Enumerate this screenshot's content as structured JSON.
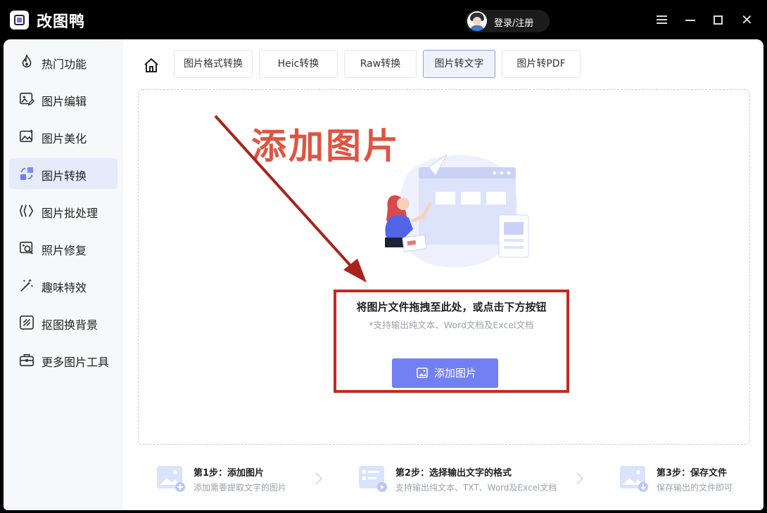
{
  "app": {
    "title": "改图鸭",
    "login_label": "登录/注册"
  },
  "sidebar": {
    "items": [
      {
        "label": "热门功能",
        "icon": "flame-icon"
      },
      {
        "label": "图片编辑",
        "icon": "image-edit-icon"
      },
      {
        "label": "图片美化",
        "icon": "image-beautify-icon"
      },
      {
        "label": "图片转换",
        "icon": "convert-icon",
        "active": true
      },
      {
        "label": "图片批处理",
        "icon": "batch-icon"
      },
      {
        "label": "照片修复",
        "icon": "photo-repair-icon"
      },
      {
        "label": "趣味特效",
        "icon": "magic-wand-icon"
      },
      {
        "label": "抠图换背景",
        "icon": "cutout-icon"
      },
      {
        "label": "更多图片工具",
        "icon": "toolbox-icon"
      }
    ]
  },
  "tabs": [
    {
      "label": "图片格式转换"
    },
    {
      "label": "Heic转换"
    },
    {
      "label": "Raw转换"
    },
    {
      "label": "图片转文字",
      "active": true
    },
    {
      "label": "图片转PDF"
    }
  ],
  "dropzone": {
    "annotation": "添加图片",
    "title": "将图片文件拖拽至此处，或点击下方按钮",
    "subtitle": "*支持输出纯文本、Word文档及Excel文档",
    "button_label": "添加图片"
  },
  "steps": [
    {
      "title": "第1步：添加图片",
      "desc": "添加需要提取文字的图片"
    },
    {
      "title": "第2步：选择输出文字的格式",
      "desc": "支持输出纯文本、TXT、Word及Excel文档"
    },
    {
      "title": "第3步：保存文件",
      "desc": "保存输出的文件即可"
    }
  ],
  "colors": {
    "accent": "#7280f4",
    "annotation_red": "#c32a1f",
    "annotation_text": "#e05442"
  }
}
